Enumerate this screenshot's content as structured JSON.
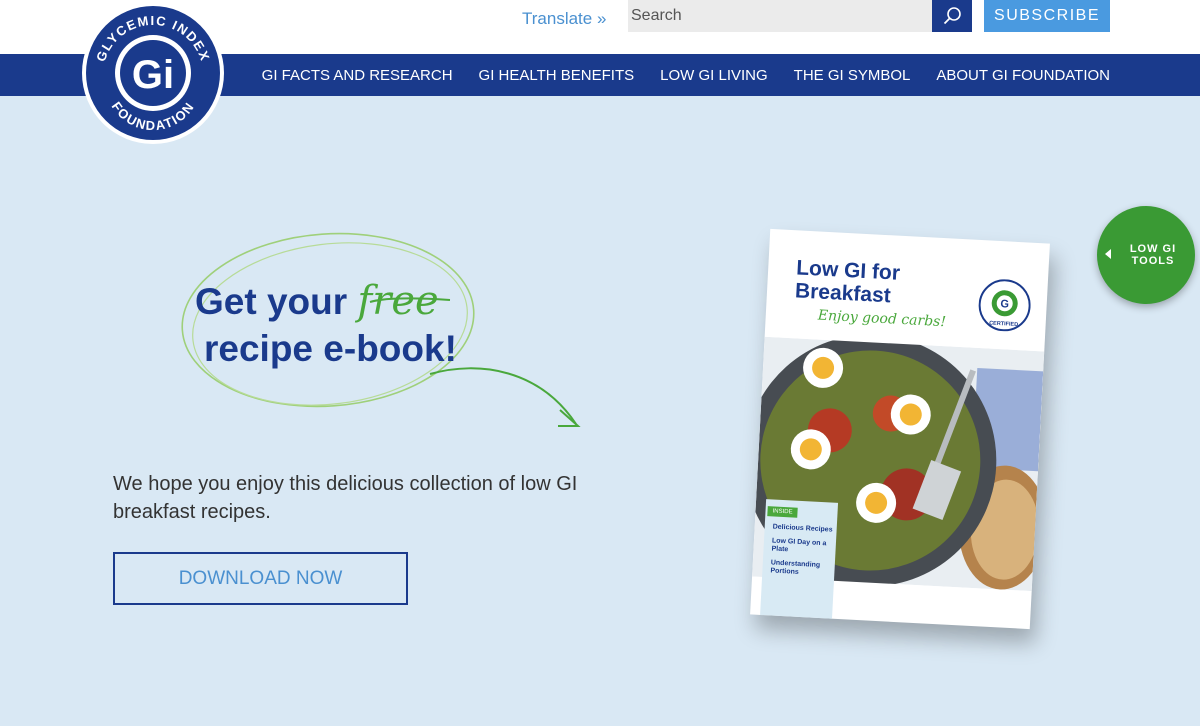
{
  "header": {
    "logo": {
      "top_text": "GLYCEMIC INDEX",
      "bottom_text": "FOUNDATION",
      "mark": "Gi"
    },
    "translate_label": "Translate »",
    "search_placeholder": "Search",
    "search_icon": "search-icon",
    "subscribe_label": "SUBSCRIBE"
  },
  "nav": {
    "items": [
      "GI FACTS AND RESEARCH",
      "GI HEALTH BENEFITS",
      "LOW GI LIVING",
      "THE GI SYMBOL",
      "ABOUT GI FOUNDATION"
    ]
  },
  "hero": {
    "headline_part1": "Get your",
    "headline_free": "free",
    "headline_part2": "recipe e-book!",
    "body": "We hope you enjoy this delicious collection of low GI breakfast recipes.",
    "download_label": "DOWNLOAD NOW"
  },
  "ebook": {
    "title_line1": "Low GI for",
    "title_line2": "Breakfast",
    "tagline": "Enjoy good carbs!",
    "certified_text": "CERTIFIED",
    "inside_label": "INSIDE",
    "inside_items": [
      "Delicious Recipes",
      "Low GI Day on a Plate",
      "Understanding Portions"
    ]
  },
  "tools": {
    "label": "LOW GI TOOLS"
  },
  "colors": {
    "navy": "#1a3a8c",
    "light_blue_bg": "#d9e8f4",
    "link_blue": "#4a90d0",
    "subscribe_blue": "#4a9ae0",
    "green": "#3a9a34",
    "accent_green": "#4aa83c"
  }
}
